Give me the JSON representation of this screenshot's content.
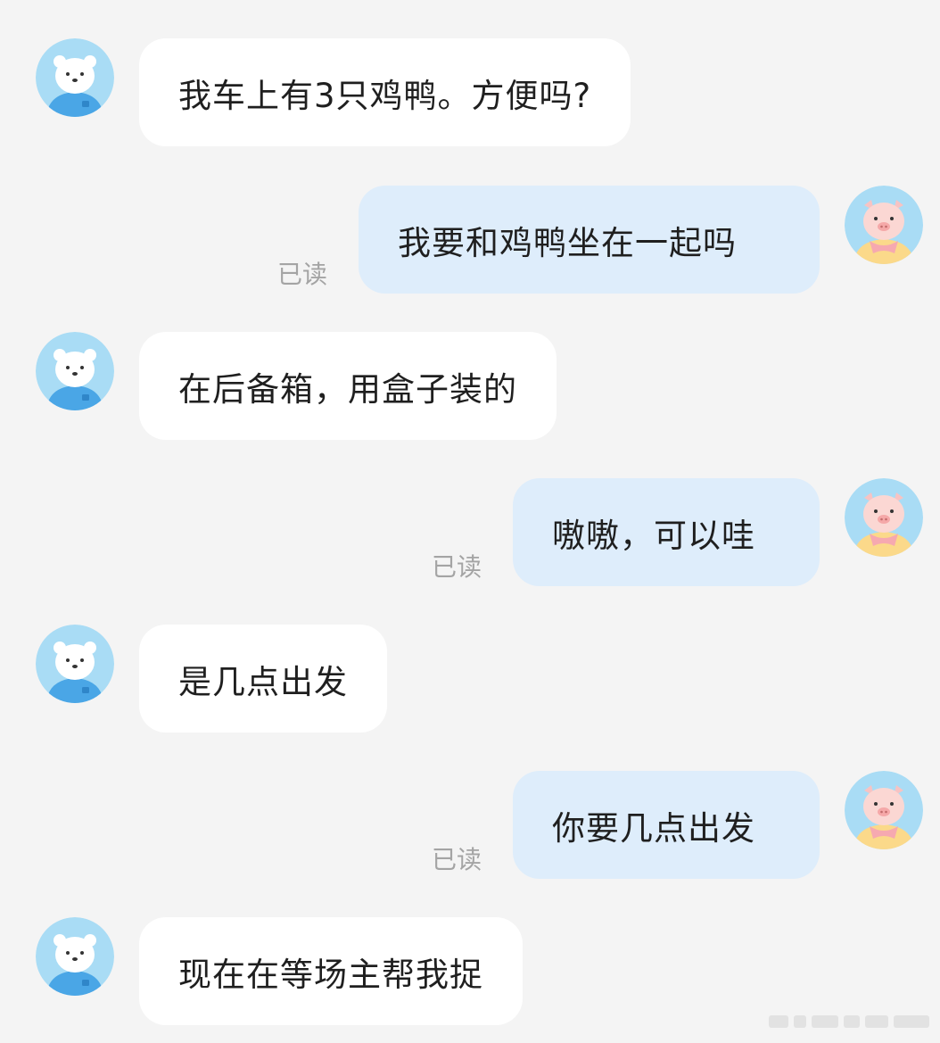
{
  "messages": [
    {
      "side": "in",
      "text": "我车上有3只鸡鸭。方便吗?",
      "avatar": "polar-bear-avatar"
    },
    {
      "side": "out",
      "text": "我要和鸡鸭坐在一起吗",
      "status": "已读",
      "avatar": "pig-avatar"
    },
    {
      "side": "in",
      "text": "在后备箱，用盒子装的",
      "avatar": "polar-bear-avatar"
    },
    {
      "side": "out",
      "text": "嗷嗷，可以哇",
      "status": "已读",
      "avatar": "pig-avatar"
    },
    {
      "side": "in",
      "text": "是几点出发",
      "avatar": "polar-bear-avatar"
    },
    {
      "side": "out",
      "text": "你要几点出发",
      "status": "已读",
      "avatar": "pig-avatar"
    },
    {
      "side": "in",
      "text": "现在在等场主帮我捉",
      "avatar": "polar-bear-avatar"
    }
  ],
  "colors": {
    "background": "#f4f4f4",
    "incoming_bubble": "#ffffff",
    "outgoing_bubble": "#deedfb",
    "read_status": "#a4a4a4"
  }
}
